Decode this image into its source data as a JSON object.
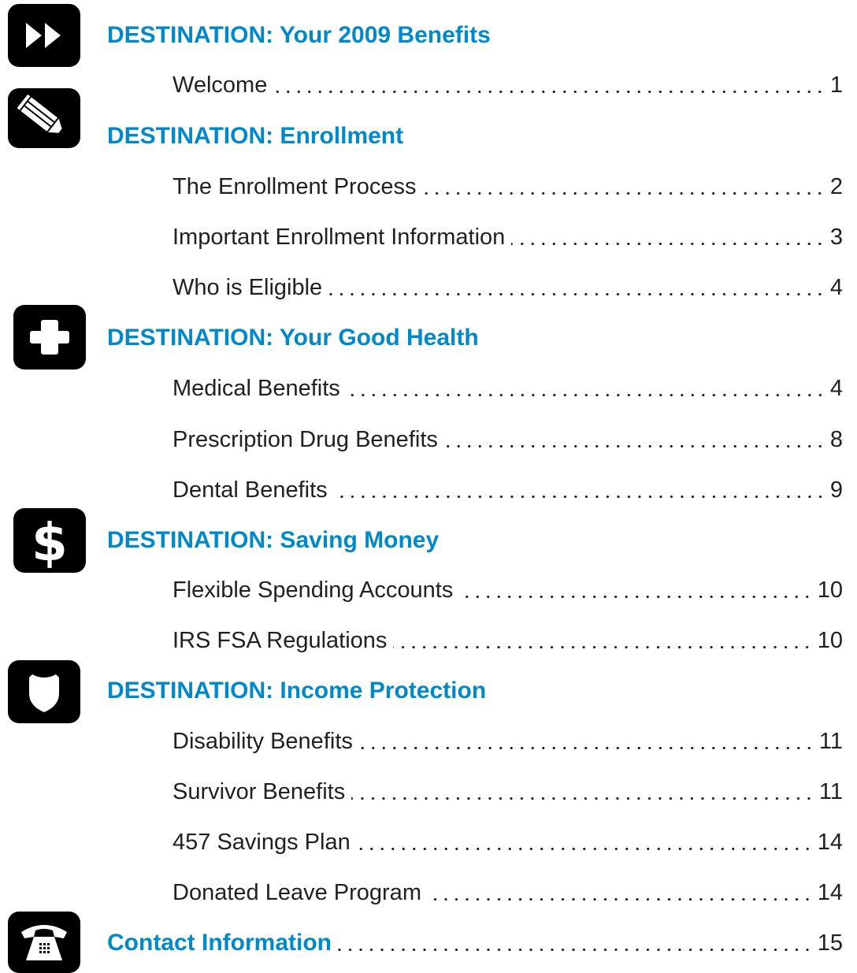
{
  "sections": [
    {
      "icon": "fast-forward-icon",
      "title": "DESTINATION: Your 2009 Benefits",
      "entries": [
        {
          "label": "Welcome",
          "page": "1"
        }
      ]
    },
    {
      "icon": "pencil-icon",
      "title": "DESTINATION: Enrollment",
      "entries": [
        {
          "label": "The Enrollment Process",
          "page": "2"
        },
        {
          "label": "Important Enrollment Information",
          "page": "3"
        },
        {
          "label": "Who is Eligible",
          "page": "4"
        }
      ]
    },
    {
      "icon": "plus-cross-icon",
      "title": "DESTINATION: Your Good Health",
      "entries": [
        {
          "label": "Medical Benefits",
          "page": "4"
        },
        {
          "label": "Prescription Drug Benefits",
          "page": "8"
        },
        {
          "label": "Dental Benefits",
          "page": "9"
        }
      ]
    },
    {
      "icon": "dollar-sign-icon",
      "title": "DESTINATION: Saving Money",
      "entries": [
        {
          "label": "Flexible Spending Accounts",
          "page": "10"
        },
        {
          "label": "IRS FSA Regulations",
          "page": "10"
        }
      ]
    },
    {
      "icon": "shield-icon",
      "title": "DESTINATION: Income Protection",
      "entries": [
        {
          "label": "Disability Benefits",
          "page": "11"
        },
        {
          "label": "Survivor Benefits",
          "page": "11"
        },
        {
          "label": "457 Savings Plan",
          "page": "14"
        },
        {
          "label": "Donated Leave Program",
          "page": "14"
        }
      ]
    },
    {
      "icon": "telephone-icon",
      "title": "Contact Information",
      "page": "15",
      "entries": []
    }
  ],
  "colors": {
    "heading": "#0089c8",
    "text": "#231f20",
    "icon_bg": "#000000"
  }
}
